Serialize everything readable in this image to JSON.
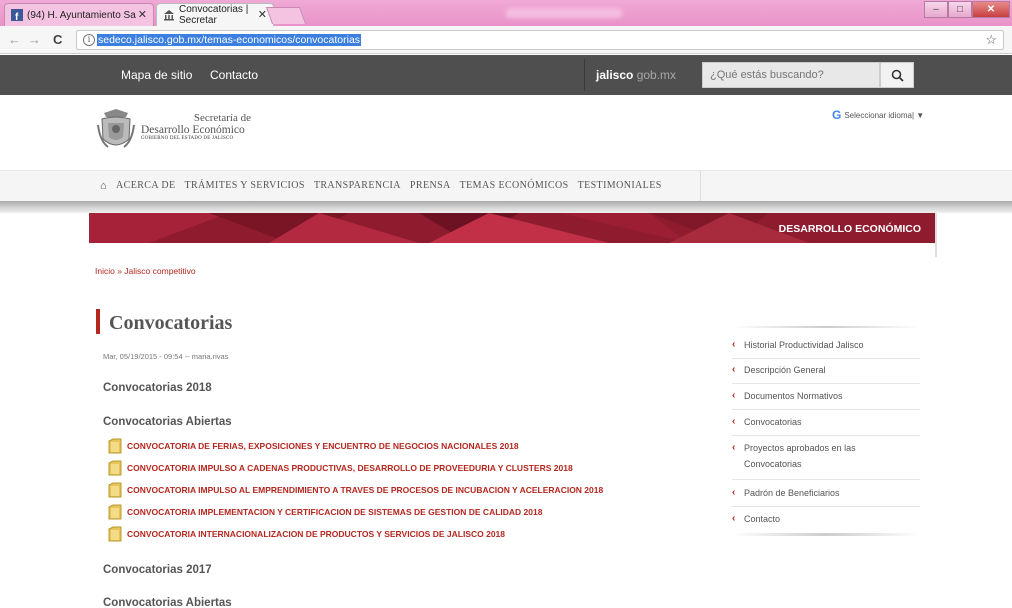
{
  "browser": {
    "tabs": [
      {
        "title": "(94) H. Ayuntamiento Sa",
        "active": false
      },
      {
        "title": "Convocatorias | Secretar",
        "active": true
      }
    ],
    "url": "sedeco.jalisco.gob.mx/temas-economicos/convocatorias",
    "window_buttons": {
      "minimize": "–",
      "maximize": "□",
      "close": "✕"
    }
  },
  "sitebar": {
    "links": [
      "Mapa de sitio",
      "Contacto"
    ],
    "brand_bold": "jalisco",
    "brand_light": " gob.mx",
    "search_placeholder": "¿Qué estás buscando?"
  },
  "header": {
    "logo_line1": "Secretaría de",
    "logo_line2": "Desarrollo Económico",
    "logo_line3": "GOBIERNO DEL ESTADO DE JALISCO",
    "translate": "Seleccionar idioma",
    "translate_g": "G",
    "translate_suffix": " | ▼"
  },
  "nav": {
    "home_icon": "⌂",
    "items": [
      "ACERCA DE",
      "TRÁMITES Y SERVICIOS",
      "TRANSPARENCIA",
      "PRENSA",
      "TEMAS ECONÓMICOS",
      "TESTIMONIALES"
    ]
  },
  "banner": {
    "title": "DESARROLLO ECONÓMICO"
  },
  "breadcrumb": "Inicio » Jalisco competitivo",
  "content": {
    "title": "Convocatorias",
    "meta": "Mar, 05/19/2015 - 09:54 -- maria.rivas",
    "section_2018": "Convocatorias 2018",
    "open_2018": "Convocatorias Abiertas",
    "items_2018": [
      "CONVOCATORIA DE FERIAS, EXPOSICIONES Y ENCUENTRO DE NEGOCIOS NACIONALES 2018",
      "CONVOCATORIA IMPULSO A CADENAS PRODUCTIVAS, DESARROLLO DE PROVEEDURIA Y CLUSTERS 2018",
      "CONVOCATORIA IMPULSO AL EMPRENDIMIENTO A TRAVES DE PROCESOS DE INCUBACION Y ACELERACION 2018",
      "CONVOCATORIA IMPLEMENTACION Y CERTIFICACION DE SISTEMAS DE GESTION DE CALIDAD 2018",
      "CONVOCATORIA INTERNACIONALIZACION DE PRODUCTOS Y SERVICIOS DE JALISCO 2018"
    ],
    "section_2017": "Convocatorias 2017",
    "open_2017": "Convocatorias Abiertas"
  },
  "sidebar": {
    "items": [
      "Historial Productividad Jalisco",
      "Descripción General",
      "Documentos Normativos",
      "Convocatorias",
      "Proyectos aprobados en las Convocatorias",
      "Padrón de Beneficiarios",
      "Contacto"
    ]
  },
  "colors": {
    "accent_red": "#b5261e",
    "banner_red": "#8e1b2e",
    "topbar_gray": "#4f4f4f",
    "chrome_pink": "#e993c9"
  }
}
